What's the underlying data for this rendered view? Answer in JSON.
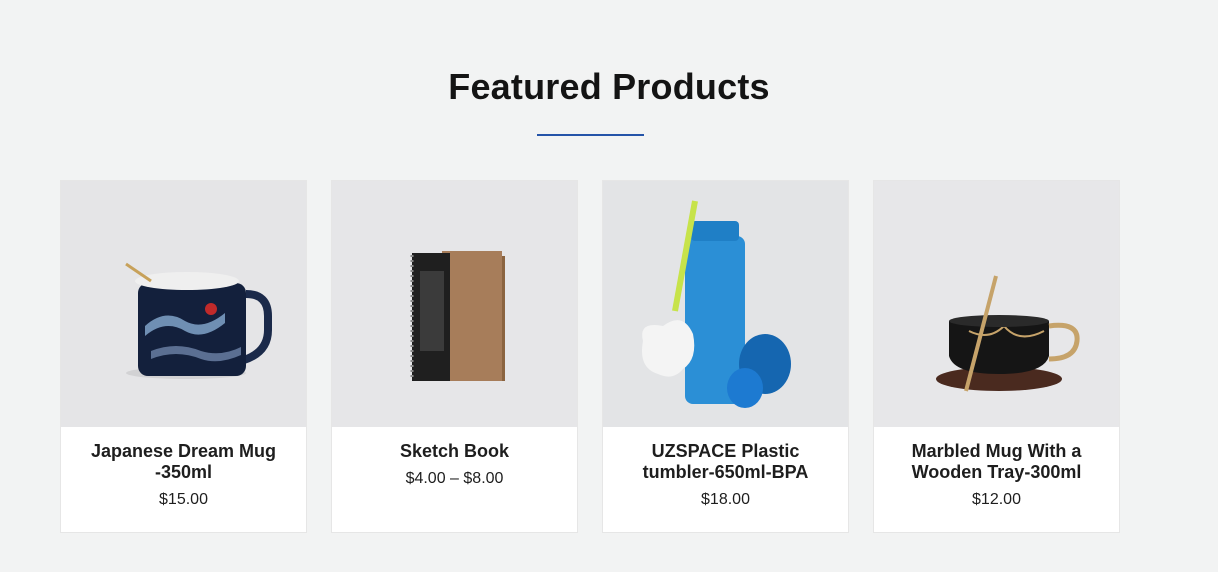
{
  "section": {
    "title": "Featured Products"
  },
  "products": [
    {
      "name": "Japanese Dream Mug -350ml",
      "price": "$15.00"
    },
    {
      "name": "Sketch Book",
      "price": "$4.00 – $8.00"
    },
    {
      "name": "UZSPACE Plastic tumbler-650ml-BPA",
      "price": "$18.00"
    },
    {
      "name": "Marbled Mug With a Wooden Tray-300ml",
      "price": "$12.00"
    }
  ],
  "colors": {
    "accent": "#2453a8",
    "background": "#f2f3f3"
  }
}
